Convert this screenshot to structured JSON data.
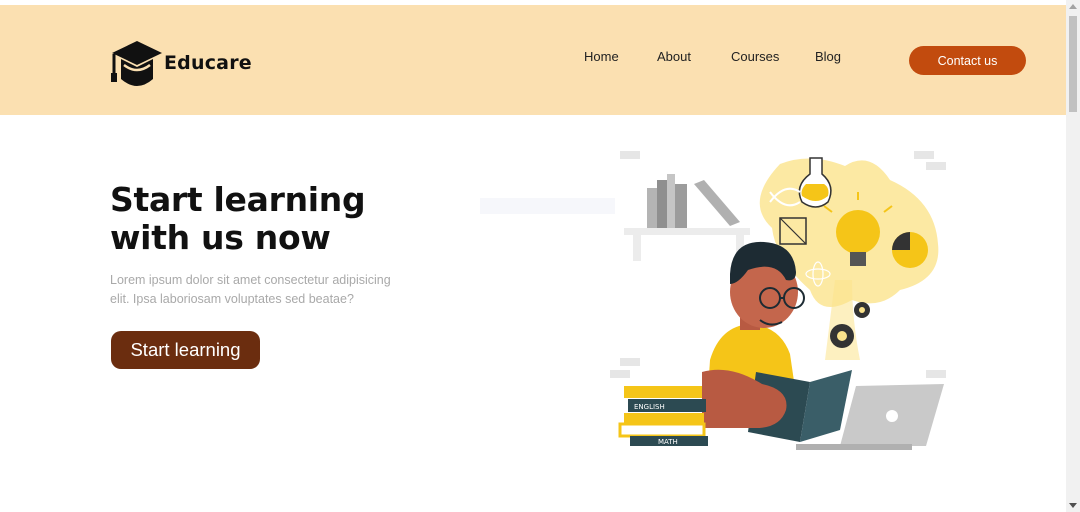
{
  "header": {
    "brand_name": "Educare",
    "brand_logo": "graduation-cap-icon",
    "nav": [
      {
        "label": "Home"
      },
      {
        "label": "About"
      },
      {
        "label": "Courses"
      },
      {
        "label": "Blog"
      }
    ],
    "contact_label": "Contact us"
  },
  "hero": {
    "title_line1": "Start learning",
    "title_line2": "with us now",
    "description_line1": "Lorem ipsum dolor sit amet consectetur adipisicing",
    "description_line2": "elit. Ipsa laboriosam voluptates sed beatae?",
    "cta_label": "Start learning",
    "illustration": "student-reading-book-illustration",
    "books": [
      "ENGLISH",
      "MATH"
    ]
  },
  "colors": {
    "header_bg": "#fbe0b1",
    "contact_button": "#c24b0e",
    "cta_button": "#6b2d0f",
    "illustration_accent": "#f5c518"
  }
}
